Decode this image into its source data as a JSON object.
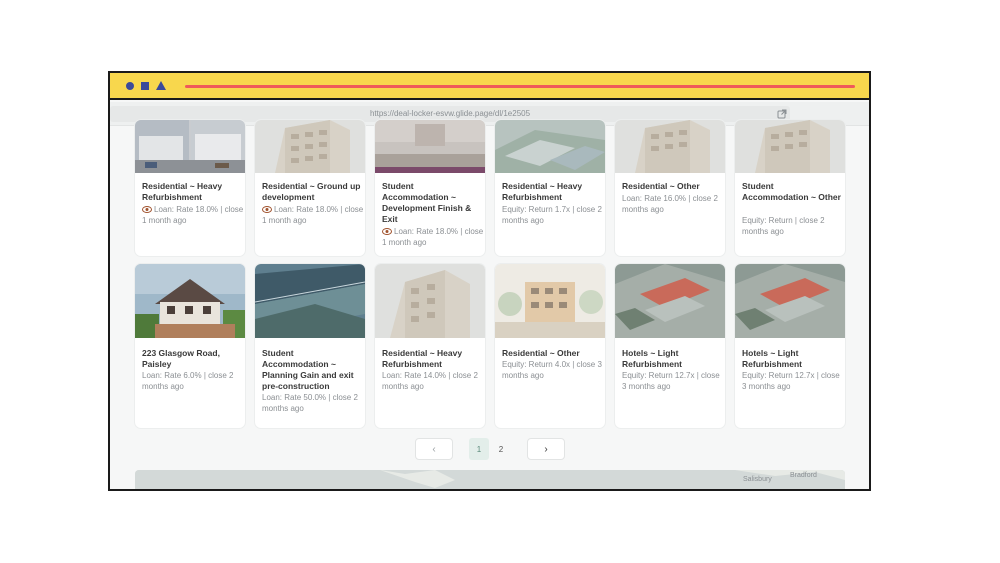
{
  "browser": {
    "url": "https://deal-locker-esvw.glide.page/dl/1e2505"
  },
  "row1": [
    {
      "title": "Residential ~ Heavy Refurbishment",
      "meta": "Loan: Rate 18.0% | close 1 month ago",
      "eye": true,
      "thumb": "street-photo"
    },
    {
      "title": "Residential ~ Ground up development",
      "meta": "Loan: Rate 18.0% | close 1 month ago",
      "eye": true,
      "thumb": "building-render"
    },
    {
      "title": "Student Accommodation ~ Development Finish & Exit",
      "meta": "Loan: Rate 18.0% | close 1 month ago",
      "eye": true,
      "thumb": "plaza-photo"
    },
    {
      "title": "Residential ~ Heavy Refurbishment",
      "meta": "Equity: Return 1.7x | close 2 months ago",
      "eye": false,
      "thumb": "aerial-render"
    },
    {
      "title": "Residential ~ Other",
      "meta": "Loan: Rate 16.0% | close 2 months ago",
      "eye": false,
      "thumb": "building-render"
    },
    {
      "title": "Student Accommodation ~ Other",
      "meta": "Equity: Return | close 2 months ago",
      "eye": false,
      "thumb": "building-render"
    }
  ],
  "row2": [
    {
      "title": "223 Glasgow Road, Paisley",
      "meta": "Loan: Rate 6.0% | close 2 months ago",
      "thumb": "house-photo"
    },
    {
      "title": "Student Accommodation ~ Planning Gain and exit pre-construction",
      "meta": "Loan: Rate 50.0% | close 2 months ago",
      "thumb": "satellite-photo"
    },
    {
      "title": "Residential ~ Heavy Refurbishment",
      "meta": "Loan: Rate 14.0% | close 2 months ago",
      "thumb": "building-render"
    },
    {
      "title": "Residential ~ Other",
      "meta": "Equity: Return 4.0x | close 3 months ago",
      "thumb": "sketch-render"
    },
    {
      "title": "Hotels ~ Light Refurbishment",
      "meta": "Equity: Return 12.7x | close 3 months ago",
      "thumb": "aerial-city"
    },
    {
      "title": "Hotels ~ Light Refurbishment",
      "meta": "Equity: Return 12.7x | close 3 months ago",
      "thumb": "aerial-city"
    }
  ],
  "pagination": {
    "prev": "‹",
    "pages": [
      "1",
      "2"
    ],
    "next": "›"
  },
  "map": {
    "label_1": "Salisbury",
    "label_2": "Bradford"
  }
}
